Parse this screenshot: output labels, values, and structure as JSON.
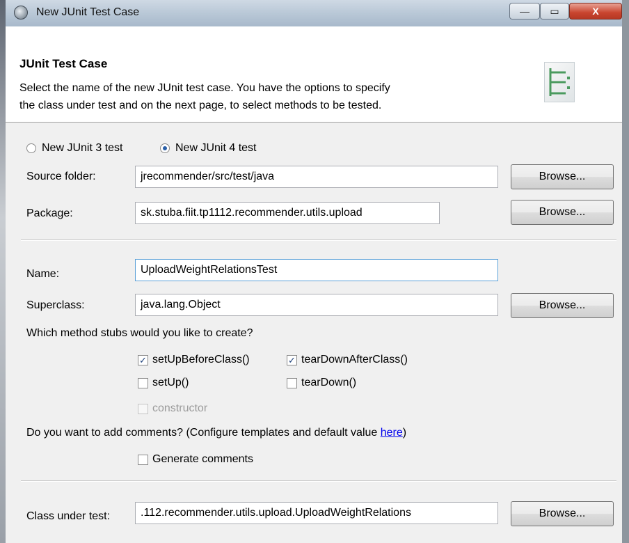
{
  "window": {
    "title": "New JUnit Test Case",
    "close_glyph": "X",
    "minimize_glyph": "—",
    "maximize_glyph": "▭"
  },
  "header": {
    "title": "JUnit Test Case",
    "description_line1": "Select the name of the new JUnit test case. You have the options to specify",
    "description_line2": "the class under test and on the next page, to select methods to be tested."
  },
  "version": {
    "junit3_label": "New JUnit 3 test",
    "junit4_label": "New JUnit 4 test",
    "selected": "junit4"
  },
  "source_folder": {
    "label": "Source folder:",
    "value": "jrecommender/src/test/java",
    "browse": "Browse..."
  },
  "package": {
    "label": "Package:",
    "value": "sk.stuba.fiit.tp1112.recommender.utils.upload",
    "browse": "Browse..."
  },
  "name": {
    "label": "Name:",
    "value": "UploadWeightRelationsTest"
  },
  "superclass": {
    "label": "Superclass:",
    "value": "java.lang.Object",
    "browse": "Browse..."
  },
  "stubs": {
    "question": "Which method stubs would you like to create?",
    "setUpBeforeClass": {
      "label": "setUpBeforeClass()",
      "checked": true
    },
    "tearDownAfterClass": {
      "label": "tearDownAfterClass()",
      "checked": true
    },
    "setUp": {
      "label": "setUp()",
      "checked": false
    },
    "tearDown": {
      "label": "tearDown()",
      "checked": false
    },
    "constructor": {
      "label": "constructor",
      "checked": false,
      "enabled": false
    }
  },
  "comments": {
    "question_prefix": "Do you want to add comments? (Configure templates and default value ",
    "link": "here",
    "question_suffix": ")",
    "generate_label": "Generate comments",
    "generate_checked": false
  },
  "class_under_test": {
    "label": "Class under test:",
    "value": ".112.recommender.utils.upload.UploadWeightRelations",
    "browse": "Browse..."
  },
  "icons": {
    "app": "eclipse-gear-icon",
    "wizard": "junit-wizard-icon"
  }
}
